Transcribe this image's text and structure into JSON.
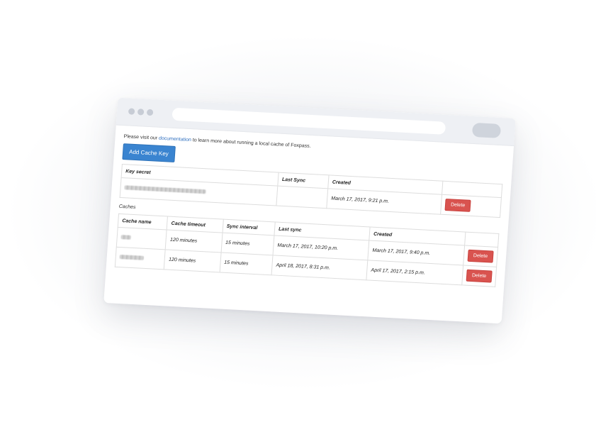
{
  "intro": {
    "before_link": "Please visit our ",
    "link_text": "documentation",
    "after_link": " to learn more about running a local cache of Foxpass."
  },
  "add_cache_key_label": "Add Cache Key",
  "keys_table": {
    "headers": [
      "Key secret",
      "Last Sync",
      "Created",
      ""
    ],
    "rows": [
      {
        "last_sync": "",
        "created": "March 17, 2017, 9:21 p.m.",
        "delete_label": "Delete"
      }
    ]
  },
  "caches_label": "Caches",
  "caches_table": {
    "headers": [
      "Cache name",
      "Cache timeout",
      "Sync interval",
      "Last sync",
      "Created",
      ""
    ],
    "rows": [
      {
        "timeout": "120 minutes",
        "interval": "15 minutes",
        "last_sync": "March 17, 2017, 10:20 p.m.",
        "created": "March 17, 2017, 9:40 p.m.",
        "delete_label": "Delete"
      },
      {
        "timeout": "120 minutes",
        "interval": "15 minutes",
        "last_sync": "April 18, 2017, 8:31 p.m.",
        "created": "April 17, 2017, 2:15 p.m.",
        "delete_label": "Delete"
      }
    ]
  },
  "colors": {
    "primary": "#3a84d0",
    "danger": "#d9534f",
    "link": "#2f6fbf",
    "chrome": "#eef0f4"
  }
}
